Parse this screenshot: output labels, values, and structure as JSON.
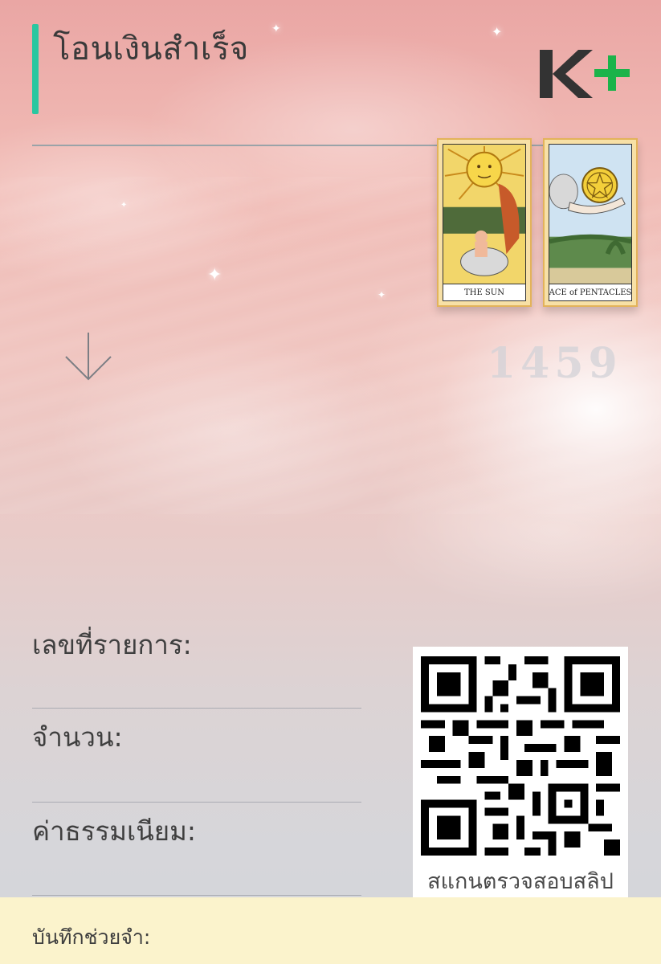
{
  "header": {
    "title": "โอนเงินสำเร็จ",
    "logo_text": "K+",
    "logo_colors": {
      "k": "#333333",
      "plus": "#1bb34a"
    },
    "accent_color": "#29c7a0"
  },
  "tarot_cards": [
    {
      "name": "THE SUN",
      "icon": "sun-card-icon"
    },
    {
      "name": "ACE of PENTACLES",
      "icon": "pentacle-card-icon"
    }
  ],
  "reference_number": "1459",
  "fields": [
    {
      "label": "เลขที่รายการ:"
    },
    {
      "label": "จำนวน:"
    },
    {
      "label": "ค่าธรรมเนียม:"
    }
  ],
  "qr": {
    "caption": "สแกนตรวจสอบสลิป",
    "icon": "qr-code-icon"
  },
  "memo": {
    "label": "บันทึกช่วยจำ:"
  },
  "icons": {
    "arrow": "arrow-down-icon"
  }
}
